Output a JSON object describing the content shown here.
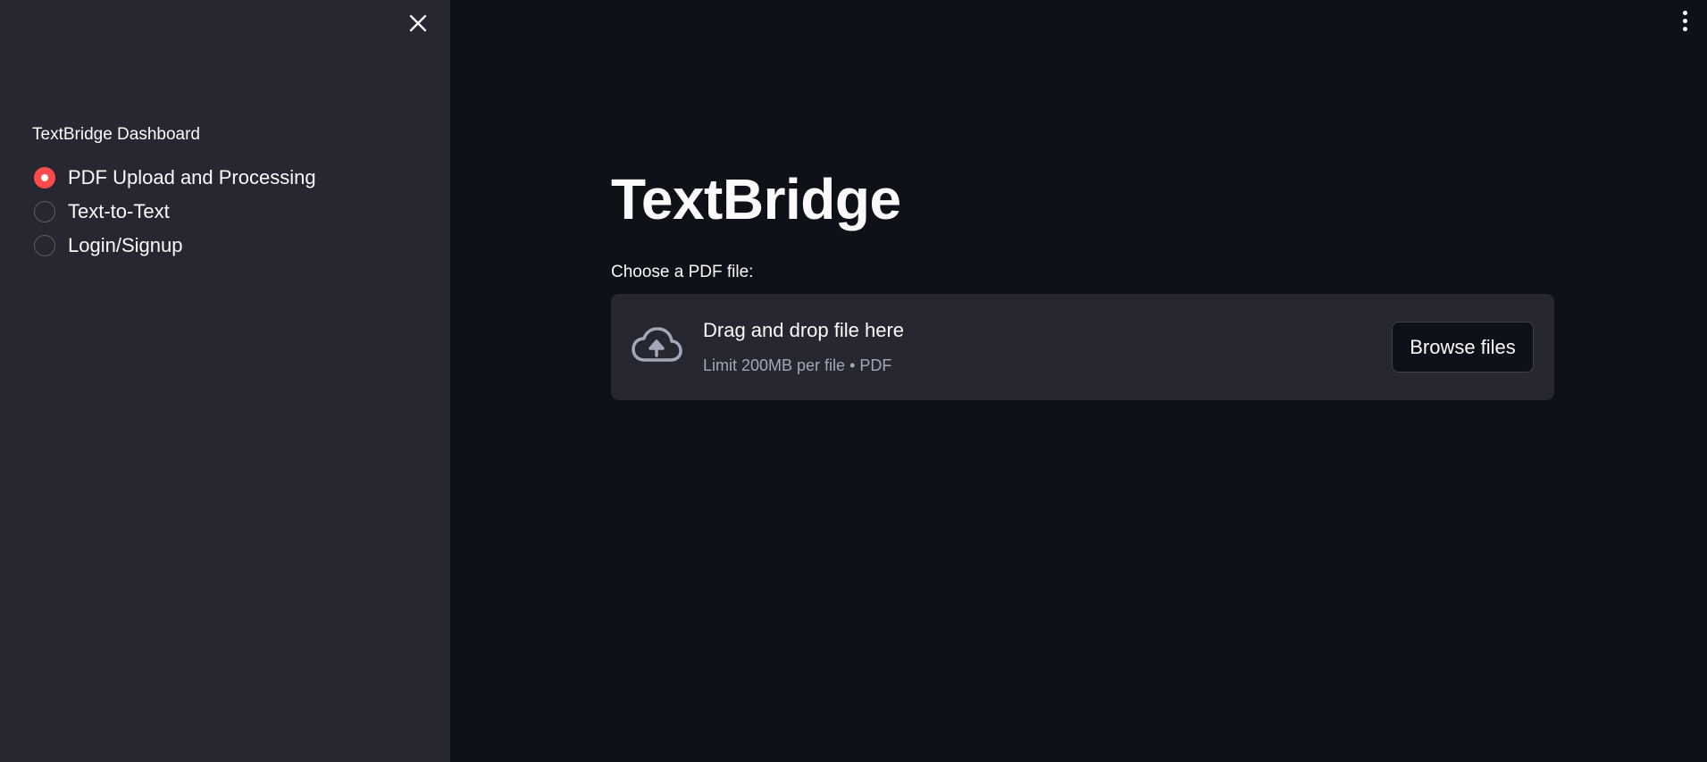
{
  "sidebar": {
    "close_icon": "close-icon",
    "title": "TextBridge Dashboard",
    "options": [
      {
        "label": "PDF Upload and Processing",
        "selected": true
      },
      {
        "label": "Text-to-Text",
        "selected": false
      },
      {
        "label": "Login/Signup",
        "selected": false
      }
    ]
  },
  "main": {
    "menu_icon": "kebab-menu-icon",
    "title": "TextBridge",
    "uploader": {
      "label": "Choose a PDF file:",
      "icon": "cloud-upload-icon",
      "drop_text": "Drag and drop file here",
      "limit_text": "Limit 200MB per file • PDF",
      "browse_label": "Browse files"
    }
  },
  "colors": {
    "main_bg": "#0e1117",
    "sidebar_bg": "#262730",
    "accent": "#ff4b4b",
    "text": "#fafafa",
    "muted_text": "#a3a8b8"
  }
}
